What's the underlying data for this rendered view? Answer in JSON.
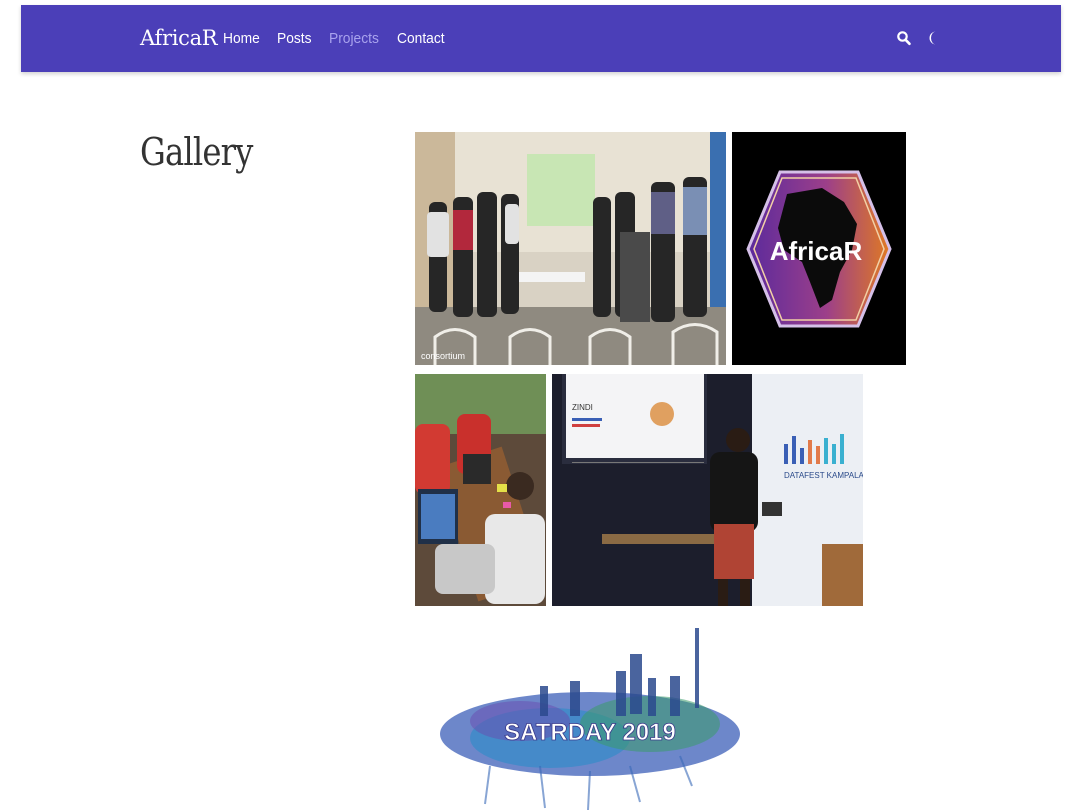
{
  "nav": {
    "brand": "AfricaR",
    "links": [
      {
        "label": "Home",
        "active": false
      },
      {
        "label": "Posts",
        "active": false
      },
      {
        "label": "Projects",
        "active": true
      },
      {
        "label": "Contact",
        "active": false
      }
    ],
    "icons": [
      "search-icon",
      "moon-icon"
    ]
  },
  "page": {
    "title": "Gallery"
  },
  "gallery": {
    "group_photo_caption": "consortium",
    "logo_text": "AfricaR",
    "datafest_label": "DATAFEST KAMPALA",
    "slide_label": "ZINDI",
    "satrday_label": "SATRDAY 2019"
  },
  "colors": {
    "navbar": "#4b3fb8",
    "active_link": "#a9a3ee",
    "logo_purple": "#6a2c9c",
    "logo_orange": "#e07a22"
  }
}
